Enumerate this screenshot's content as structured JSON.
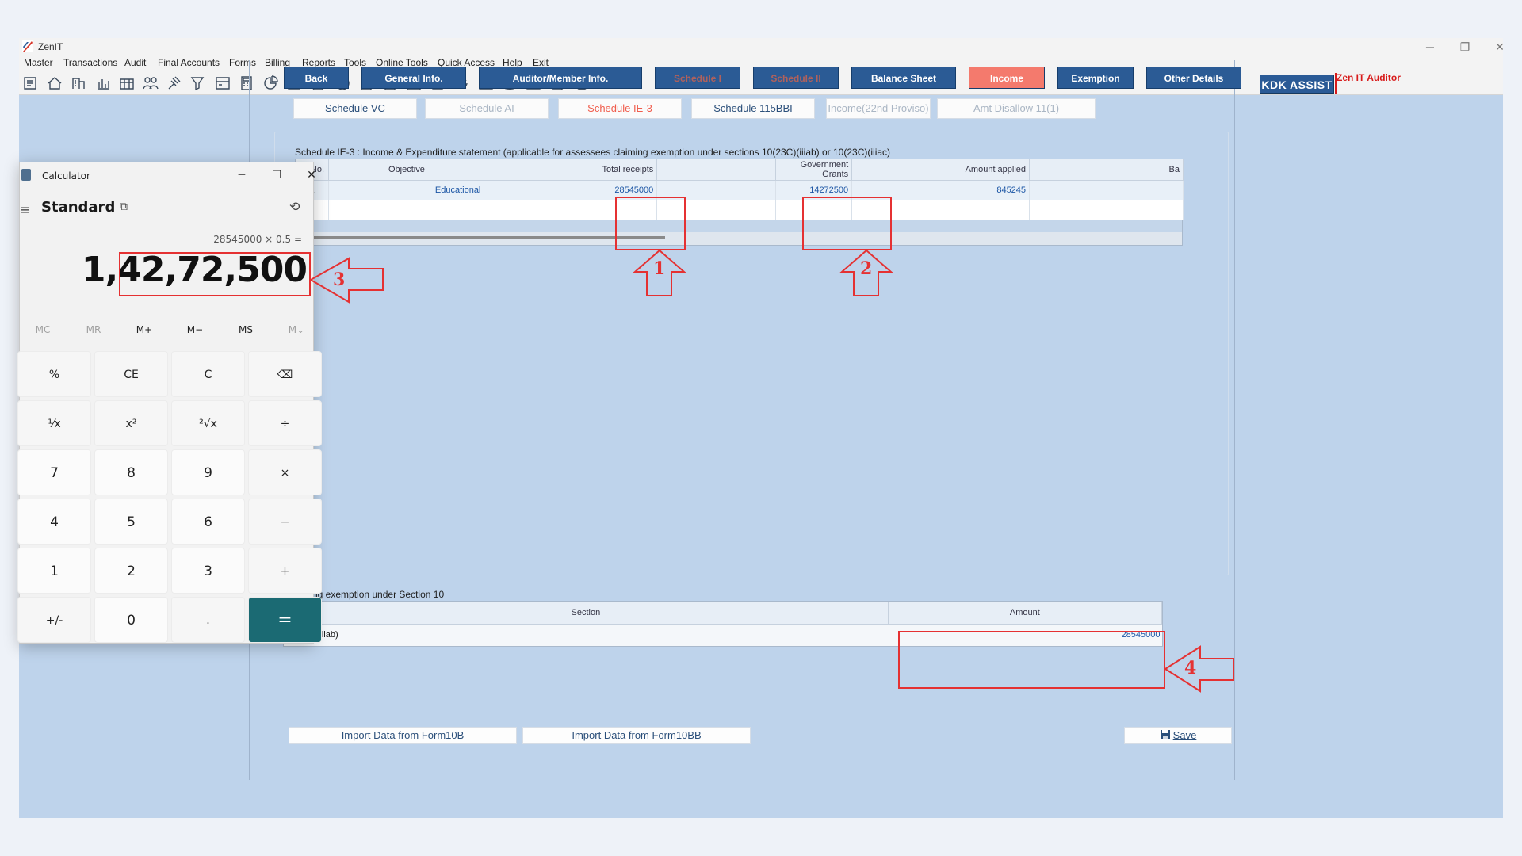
{
  "window": {
    "title": "ZenIT",
    "controls": [
      "─",
      "❐",
      "✕"
    ]
  },
  "menu": [
    "Master",
    "Transactions",
    "Audit",
    "Final Accounts",
    "Forms",
    "Billing",
    "Reports",
    "Tools",
    "Online Tools",
    "Quick Access",
    "Help",
    "Exit"
  ],
  "toolbar": {
    "icons": [
      "ledger-icon",
      "home-icon",
      "building-icon",
      "bar-chart-icon",
      "calendar-grid-icon",
      "users-icon",
      "gavel-icon",
      "tax-filter-icon",
      "tax-card-icon",
      "calculator-icon",
      "pie-chart-icon",
      "pay-icon",
      "book-icon",
      "info-icon",
      "report-icon",
      "document-add-icon",
      "calendar-icon",
      "refresh-doc-icon",
      "sync-icon",
      "form-icon",
      "database-icon",
      "form-3cd-icon",
      "clipboard-icon",
      "close-circle-icon"
    ],
    "kdk_assist": "KDK ASSIST",
    "zen_auditor": "Zen IT Auditor"
  },
  "nav_tabs": [
    {
      "label": "Back",
      "state": "normal"
    },
    {
      "label": "General Info.",
      "state": "normal"
    },
    {
      "label": "Auditor/Member Info.",
      "state": "normal"
    },
    {
      "label": "Schedule I",
      "state": "disabled"
    },
    {
      "label": "Schedule II",
      "state": "disabled"
    },
    {
      "label": "Balance Sheet",
      "state": "normal"
    },
    {
      "label": "Income",
      "state": "active"
    },
    {
      "label": "Exemption",
      "state": "normal"
    },
    {
      "label": "Other Details",
      "state": "normal"
    }
  ],
  "schedule_tabs": [
    {
      "label": "Schedule VC",
      "state": "normal"
    },
    {
      "label": "Schedule AI",
      "state": "disabled"
    },
    {
      "label": "Schedule IE-3",
      "state": "active"
    },
    {
      "label": "Schedule 115BBI",
      "state": "normal"
    },
    {
      "label": "Income(22nd Proviso)",
      "state": "disabled"
    },
    {
      "label": "Amt Disallow 11(1)",
      "state": "disabled"
    }
  ],
  "ie3": {
    "title": "Schedule IE-3 : Income & Expenditure statement (applicable for assessees claiming exemption under sections 10(23C)(iiiab) or 10(23C)(iiiac)",
    "columns": [
      "Sr.No.",
      "Objective",
      "",
      "Total receipts",
      "",
      "Government Grants",
      "Amount applied",
      "Ba"
    ],
    "rows": [
      [
        "1",
        "Educational",
        "",
        "28545000",
        "",
        "14272500",
        "845245",
        ""
      ],
      [
        "1",
        "",
        "",
        "",
        "",
        "",
        "",
        ""
      ]
    ]
  },
  "exemption": {
    "title": "aiming exemption under Section 10",
    "columns": [
      "Section",
      "Amount"
    ],
    "rows": [
      [
        "10(23C)(iiiab)",
        "28545000"
      ]
    ]
  },
  "bottom_buttons": {
    "import_10b": "Import Data from Form10B",
    "import_10bb": "Import Data from Form10BB",
    "save": "Save"
  },
  "calculator": {
    "title": "Calculator",
    "mode": "Standard",
    "expression": "28545000 × 0.5 =",
    "display": "1,42,72,500",
    "memory": [
      {
        "label": "MC",
        "enabled": false
      },
      {
        "label": "MR",
        "enabled": false
      },
      {
        "label": "M+",
        "enabled": true
      },
      {
        "label": "M−",
        "enabled": true
      },
      {
        "label": "MS",
        "enabled": true
      },
      {
        "label": "M⌄",
        "enabled": false
      }
    ],
    "keys": [
      [
        "%",
        "CE",
        "C",
        "⌫"
      ],
      [
        "¹⁄x",
        "x²",
        "²√x",
        "÷"
      ],
      [
        "7",
        "8",
        "9",
        "×"
      ],
      [
        "4",
        "5",
        "6",
        "−"
      ],
      [
        "1",
        "2",
        "3",
        "+"
      ],
      [
        "+/-",
        "0",
        ".",
        "="
      ]
    ]
  },
  "annotations": [
    "1",
    "2",
    "3",
    "4"
  ],
  "colors": {
    "accent_red": "#e53132",
    "nav_blue": "#2b5b95",
    "active_tab": "#f47a6d",
    "equals_teal": "#1b6a73",
    "value_blue": "#1c56a5"
  }
}
